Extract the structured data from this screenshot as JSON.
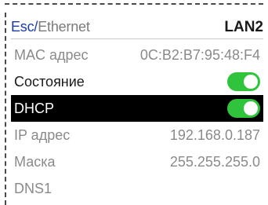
{
  "header": {
    "back_label": "Esc",
    "separator": "/",
    "title": "Ethernet",
    "interface": "LAN2"
  },
  "rows": [
    {
      "label": "MAC адрес",
      "value": "0C:B2:B7:95:48:F4"
    },
    {
      "label": "Состояние",
      "toggle": "on"
    },
    {
      "label": "DHCP",
      "toggle": "on"
    },
    {
      "label": "IP адрес",
      "value": "192.168.0.187"
    },
    {
      "label": "Маска",
      "value": "255.255.255.0"
    },
    {
      "label": "DNS1",
      "value": ""
    }
  ],
  "colors": {
    "accent": "#1a3aa8",
    "toggle_on": "#2fc43c",
    "selected_bg": "#000000"
  }
}
